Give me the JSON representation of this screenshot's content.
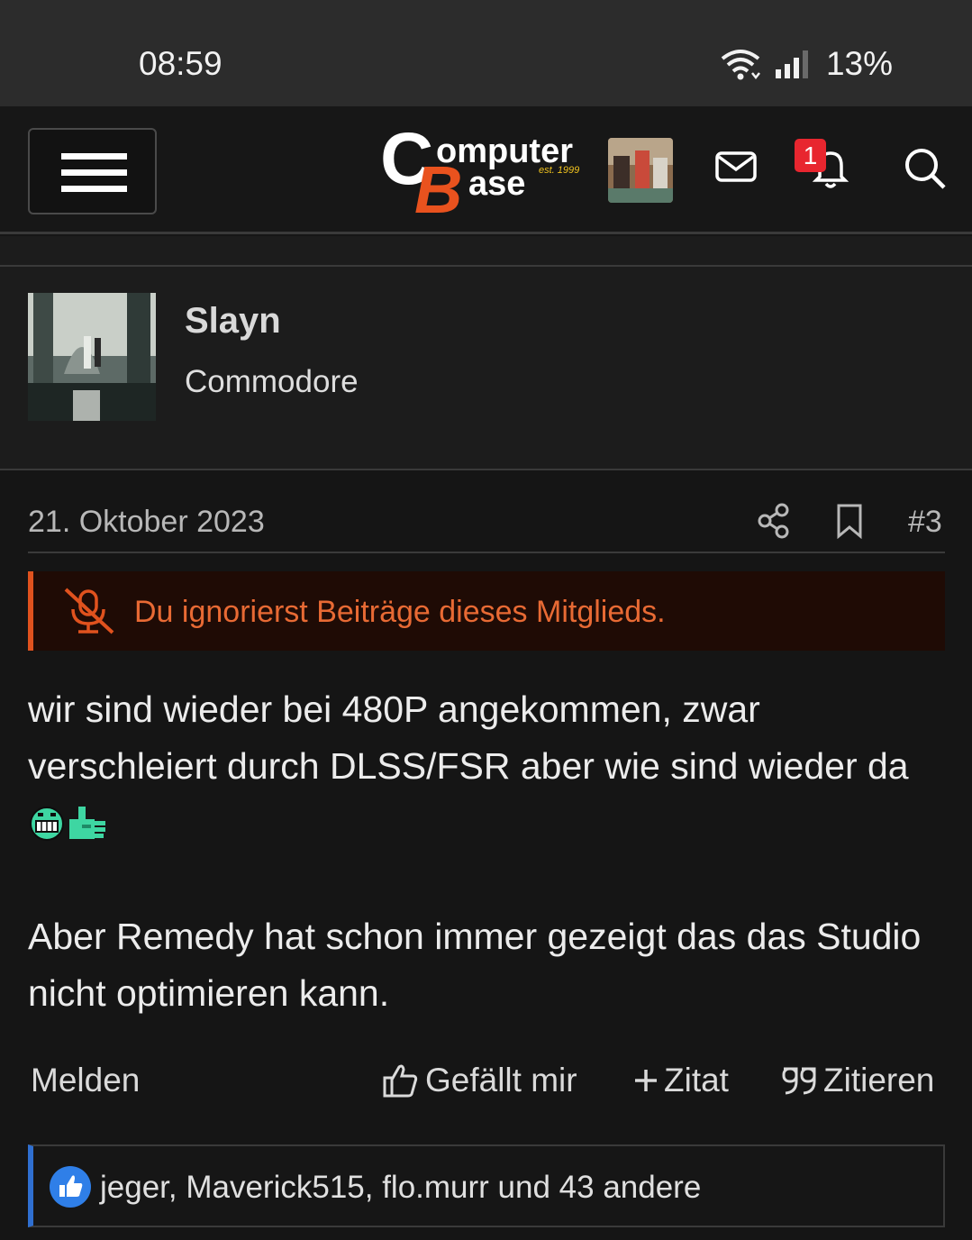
{
  "status": {
    "time": "08:59",
    "battery": "13%"
  },
  "header": {
    "logo_text_main": "omputer",
    "logo_text_sub": "ase",
    "logo_est": "est. 1999",
    "notification_count": "1"
  },
  "user": {
    "name": "Slayn",
    "title": "Commodore"
  },
  "post": {
    "date": "21. Oktober 2023",
    "number": "#3",
    "ignored_notice": "Du ignorierst Beiträge dieses Mitglieds.",
    "body_line1": "wir sind wieder bei 480P angekommen, zwar verschleiert durch DLSS/FSR aber wie sind wieder da",
    "body_line2": "Aber Remedy hat schon immer gezeigt das das Studio nicht optimieren kann."
  },
  "actions": {
    "report": "Melden",
    "like": "Gefällt mir",
    "quote_add": "Zitat",
    "quote": "Zitieren"
  },
  "reactions": {
    "text": "jeger, Maverick515, flo.murr und 43 andere"
  },
  "colors": {
    "accent_orange": "#e0521e",
    "badge_red": "#e8262f",
    "like_blue": "#2f7fe8"
  }
}
